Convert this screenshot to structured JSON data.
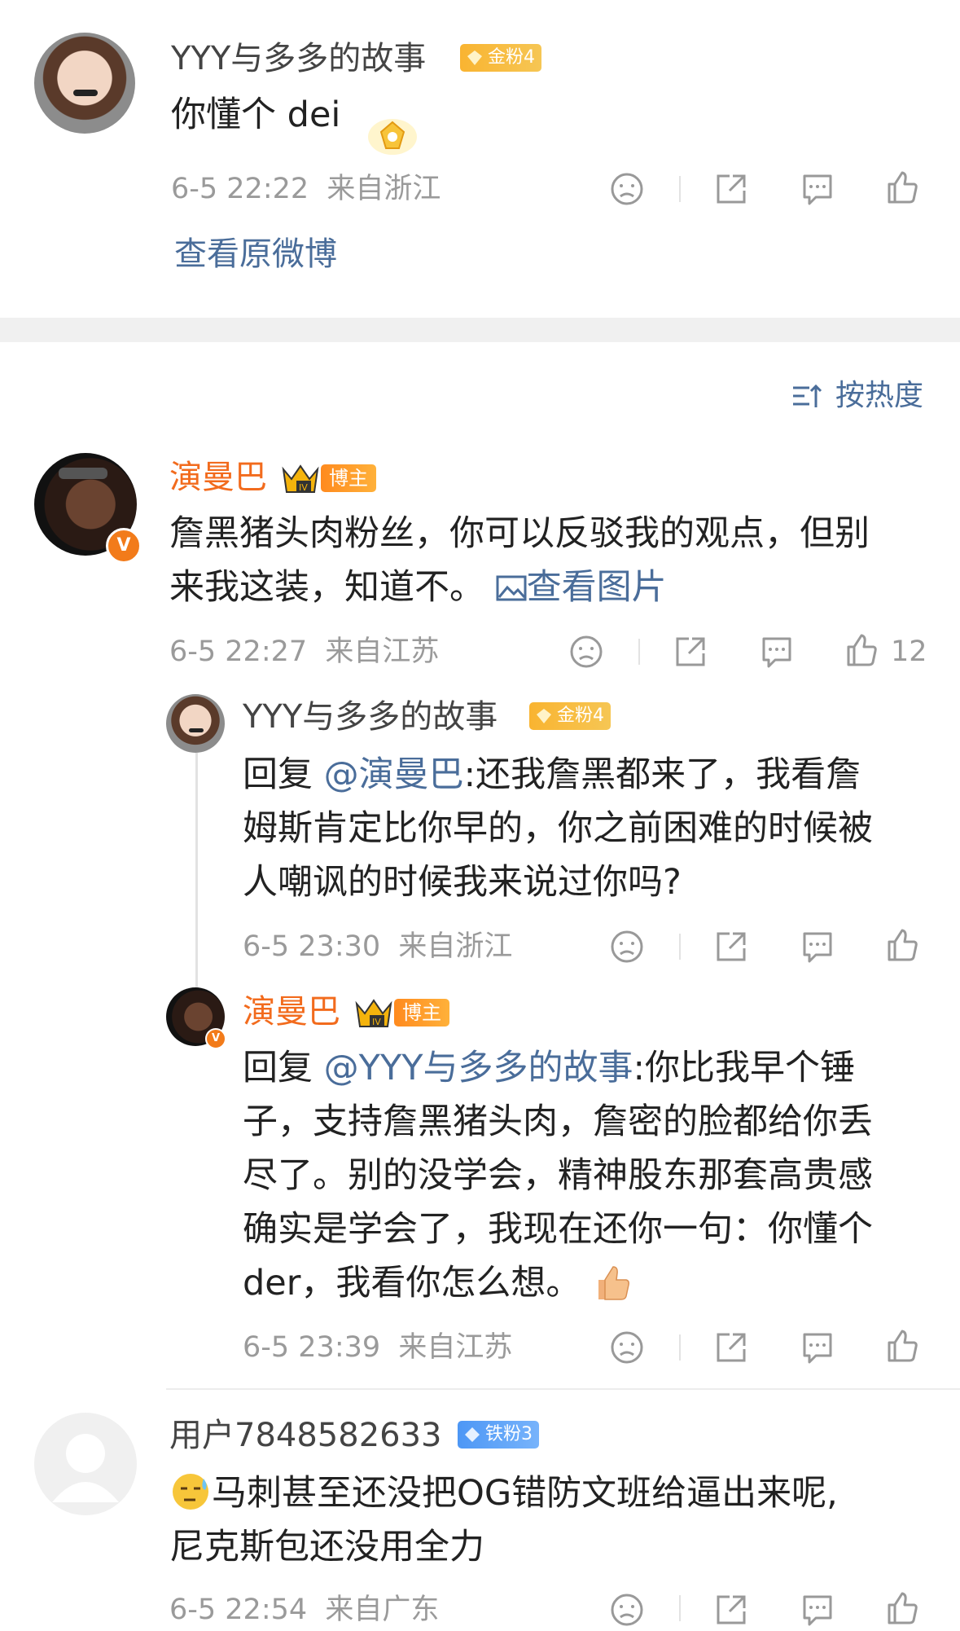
{
  "top_comment": {
    "user": "YYY与多多的故事",
    "badge": "金粉4",
    "text": "你懂个 dei",
    "time": "6-5 22:22",
    "location": "来自浙江",
    "view_original": "查看原微博"
  },
  "sort": {
    "label": "按热度"
  },
  "comments": [
    {
      "user": "演曼巴",
      "badge": "博主",
      "text_line1": "詹黑猪头肉粉丝，你可以反驳我的观点，但别",
      "text_line2_prefix": "来我这装，知道不。",
      "view_image": "查看图片",
      "time": "6-5 22:27",
      "location": "来自江苏",
      "likes": "12"
    }
  ],
  "replies": [
    {
      "user": "YYY与多多的故事",
      "badge": "金粉4",
      "prefix": "回复",
      "mention": "@演曼巴",
      "line1_rest": ":还我詹黑都来了，我看詹",
      "line2": "姆斯肯定比你早的，你之前困难的时候被",
      "line3": "人嘲讽的时候我来说过你吗?",
      "time": "6-5 23:30",
      "location": "来自浙江"
    },
    {
      "user": "演曼巴",
      "badge": "博主",
      "prefix": "回复",
      "mention": "@YYY与多多的故事",
      "line1_rest": ":你比我早个锤",
      "line2": "子，支持詹黑猪头肉，詹密的脸都给你丢",
      "line3": "尽了。别的没学会，精神股东那套高贵感",
      "line4": "确实是学会了，我现在还你一句：你懂个",
      "line5": "der，我看你怎么想。",
      "time": "6-5 23:39",
      "location": "来自江苏"
    }
  ],
  "bottom_comment": {
    "user": "用户7848582633",
    "badge": "铁粉3",
    "line1": "马刺甚至还没把OG错防文班给逼出来呢,",
    "line2": "尼克斯包还没用全力",
    "time": "6-5 22:54",
    "location": "来自广东"
  },
  "colors": {
    "orange": "#f26b1d",
    "link": "#4a6d9a",
    "meta": "#9a9a9a"
  }
}
